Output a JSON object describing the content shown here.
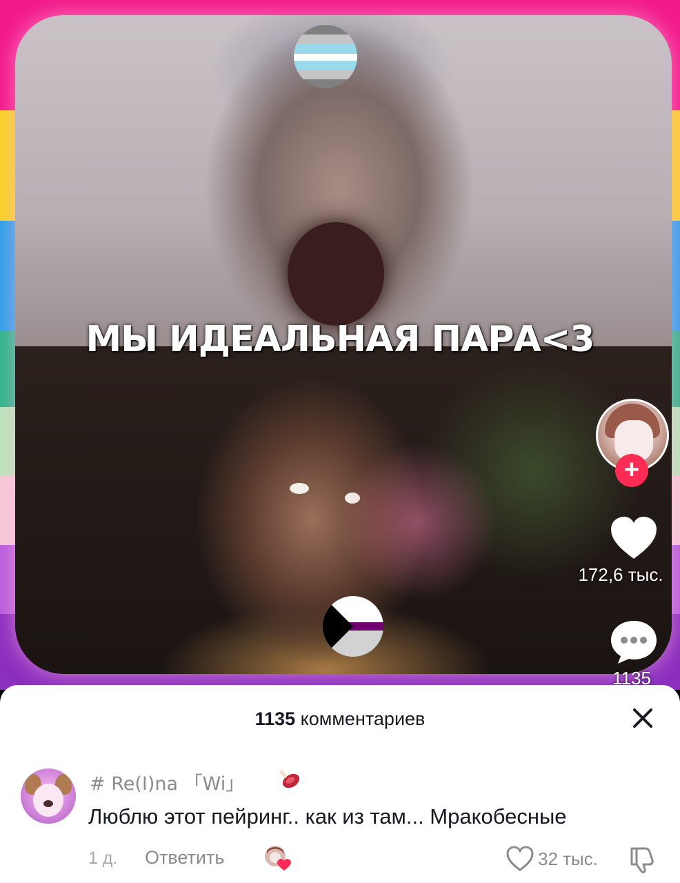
{
  "video": {
    "overlay_text": "МЫ ИДЕАЛЬНАЯ ПАРА<3",
    "background_stripes": [
      "#f21a8b",
      "#f9d127",
      "#2fa0e8",
      "#2fb48c",
      "#b9e5ba",
      "#f6c9d7",
      "#b95edd",
      "#8b2fbf"
    ]
  },
  "actions": {
    "profile_icon": "creator-avatar",
    "follow_icon": "plus-icon",
    "like_icon": "heart-icon",
    "like_count": "172,6 тыс.",
    "comment_icon": "comment-bubble-icon",
    "comment_count": "1135"
  },
  "comments_sheet": {
    "count": "1135",
    "title_suffix": "комментариев",
    "close_icon": "close-icon",
    "comments": [
      {
        "username": "# Re(I)na 「Wi」",
        "badge_icon": "meat-icon",
        "text": "Люблю этот пейринг.. как из там... Мракобесные",
        "time": "1 д.",
        "reply_label": "Ответить",
        "creator_liked_icon": "creator-liked-icon",
        "like_count": "32 тыс.",
        "like_icon": "heart-outline-icon",
        "dislike_icon": "thumbs-down-icon"
      }
    ]
  },
  "colors": {
    "accent": "#fe2c55",
    "text_primary": "#161823",
    "text_secondary": "#8a8b91"
  }
}
